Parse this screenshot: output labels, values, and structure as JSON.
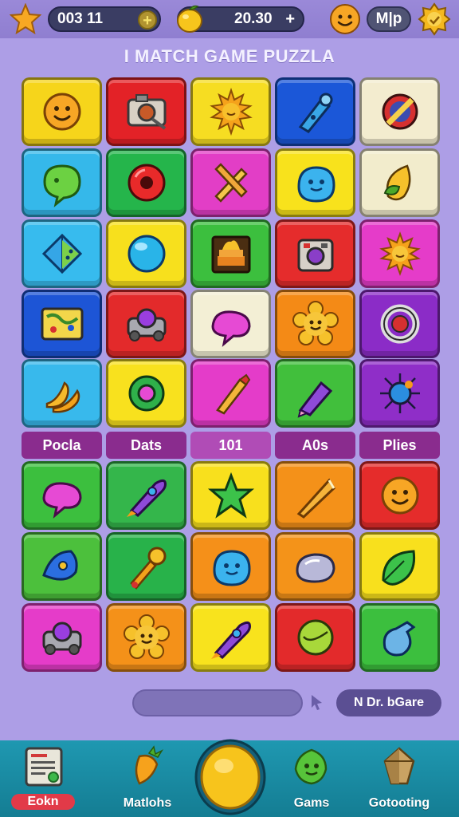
{
  "top_bar": {
    "score": "003 11",
    "score_plus": "+",
    "coins": "20.30",
    "coins_plus": "+",
    "mode_badge": "M|p"
  },
  "title": "I MATCH GAME PUZZLA",
  "rows_top": [
    [
      {
        "icon": "smiley-icon",
        "color": "#f6d51b"
      },
      {
        "icon": "camera-icon",
        "color": "#e32227"
      },
      {
        "icon": "sun-icon",
        "color": "#f6dd22"
      },
      {
        "icon": "pen-icon",
        "color": "#1b57d8"
      },
      {
        "icon": "no-sign-icon",
        "color": "#f3eccf"
      }
    ],
    [
      {
        "icon": "chat-bubble-icon",
        "color": "#35b8ea"
      },
      {
        "icon": "red-donut-icon",
        "color": "#25b54b"
      },
      {
        "icon": "crossed-pencils-icon",
        "color": "#e23ec6"
      },
      {
        "icon": "blue-blob-icon",
        "color": "#f8e21c"
      },
      {
        "icon": "leaf-face-icon",
        "color": "#f2eccc"
      }
    ],
    [
      {
        "icon": "gem-icon",
        "color": "#37bbee"
      },
      {
        "icon": "blue-ball-icon",
        "color": "#f7e01d"
      },
      {
        "icon": "cake-icon",
        "color": "#3cbf3e"
      },
      {
        "icon": "gadget-icon",
        "color": "#e52c2c"
      },
      {
        "icon": "sun-smile-icon",
        "color": "#e53cc9"
      }
    ],
    [
      {
        "icon": "map-icon",
        "color": "#1d55d6"
      },
      {
        "icon": "robot-icon",
        "color": "#e32a2b"
      },
      {
        "icon": "pink-blob-icon",
        "color": "#f3efd5"
      },
      {
        "icon": "flower-face-icon",
        "color": "#f48a16"
      },
      {
        "icon": "ring-icon",
        "color": "#8b2cc7"
      }
    ],
    [
      {
        "icon": "banana-icon",
        "color": "#38b9ec"
      },
      {
        "icon": "green-ring-icon",
        "color": "#f8e11e"
      },
      {
        "icon": "brush-icon",
        "color": "#e43cc9"
      },
      {
        "icon": "marker-icon",
        "color": "#41bf3c"
      },
      {
        "icon": "star-bug-icon",
        "color": "#8f2ec8"
      }
    ]
  ],
  "categories": [
    "Pocla",
    "Dats",
    "101",
    "A0s",
    "Plies"
  ],
  "rows_bottom": [
    [
      {
        "icon": "pink-blob-icon",
        "color": "#3cbf3e"
      },
      {
        "icon": "rocket-icon",
        "color": "#34b64b"
      },
      {
        "icon": "green-star-icon",
        "color": "#f8e01d"
      },
      {
        "icon": "cone-icon",
        "color": "#f49119"
      },
      {
        "icon": "smiley-icon",
        "color": "#e52c2b"
      }
    ],
    [
      {
        "icon": "fish-icon",
        "color": "#4cc03c"
      },
      {
        "icon": "torch-icon",
        "color": "#28b24a"
      },
      {
        "icon": "blue-blob-icon",
        "color": "#f59019"
      },
      {
        "icon": "stone-icon",
        "color": "#f49319"
      },
      {
        "icon": "leaf-icon",
        "color": "#f8e01d"
      }
    ],
    [
      {
        "icon": "robot-icon",
        "color": "#e53cc9"
      },
      {
        "icon": "flower-face-icon",
        "color": "#f49119"
      },
      {
        "icon": "rocket-icon",
        "color": "#f8e31d"
      },
      {
        "icon": "green-ball-icon",
        "color": "#e32a2b"
      },
      {
        "icon": "jug-icon",
        "color": "#3cbf3e"
      }
    ]
  ],
  "bottom_controls": {
    "mode_label": "N Dr. bGare"
  },
  "nav": {
    "items": [
      {
        "label": "Eokn",
        "icon": "notebook-icon"
      },
      {
        "label": "Matlohs",
        "icon": "carrot-icon"
      },
      {
        "label": "Gams",
        "icon": "leaf-badge-icon"
      },
      {
        "label": "Gotooting",
        "icon": "crystal-icon"
      }
    ]
  },
  "colors": {
    "background": "#ad9ee6",
    "nav": "#1f98b1",
    "category": "#8a2c8e"
  }
}
